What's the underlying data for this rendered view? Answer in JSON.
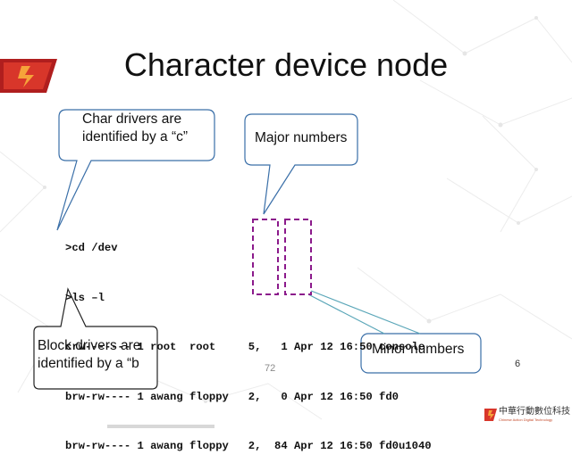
{
  "slide": {
    "title": "Character device node",
    "page_number": "72",
    "slide_number": "6"
  },
  "terminal": {
    "lines": [
      ">cd /dev",
      ">ls –l",
      "crw------- 1 root  root     5,   1 Apr 12 16:50 console",
      "brw-rw---- 1 awang floppy   2,   0 Apr 12 16:50 fd0",
      "brw-rw---- 1 awang floppy   2,  84 Apr 12 16:50 fd0u1040"
    ]
  },
  "callouts": {
    "char_drivers": "Char drivers are\nidentified by a “c”",
    "major_numbers": "Major numbers",
    "minor_numbers": "Minor numbers",
    "block_drivers": "Block drivers are\nidentified by a “b"
  },
  "footer": {
    "company_name": "中華行動數位科技",
    "company_subtitle": "Chinese Action Digital Technology"
  },
  "colors": {
    "accent": "#e8542a",
    "dash_box": "#8b1a8b",
    "callout_stroke": "#3a6fa8",
    "minor_line": "#5aa6b8"
  }
}
